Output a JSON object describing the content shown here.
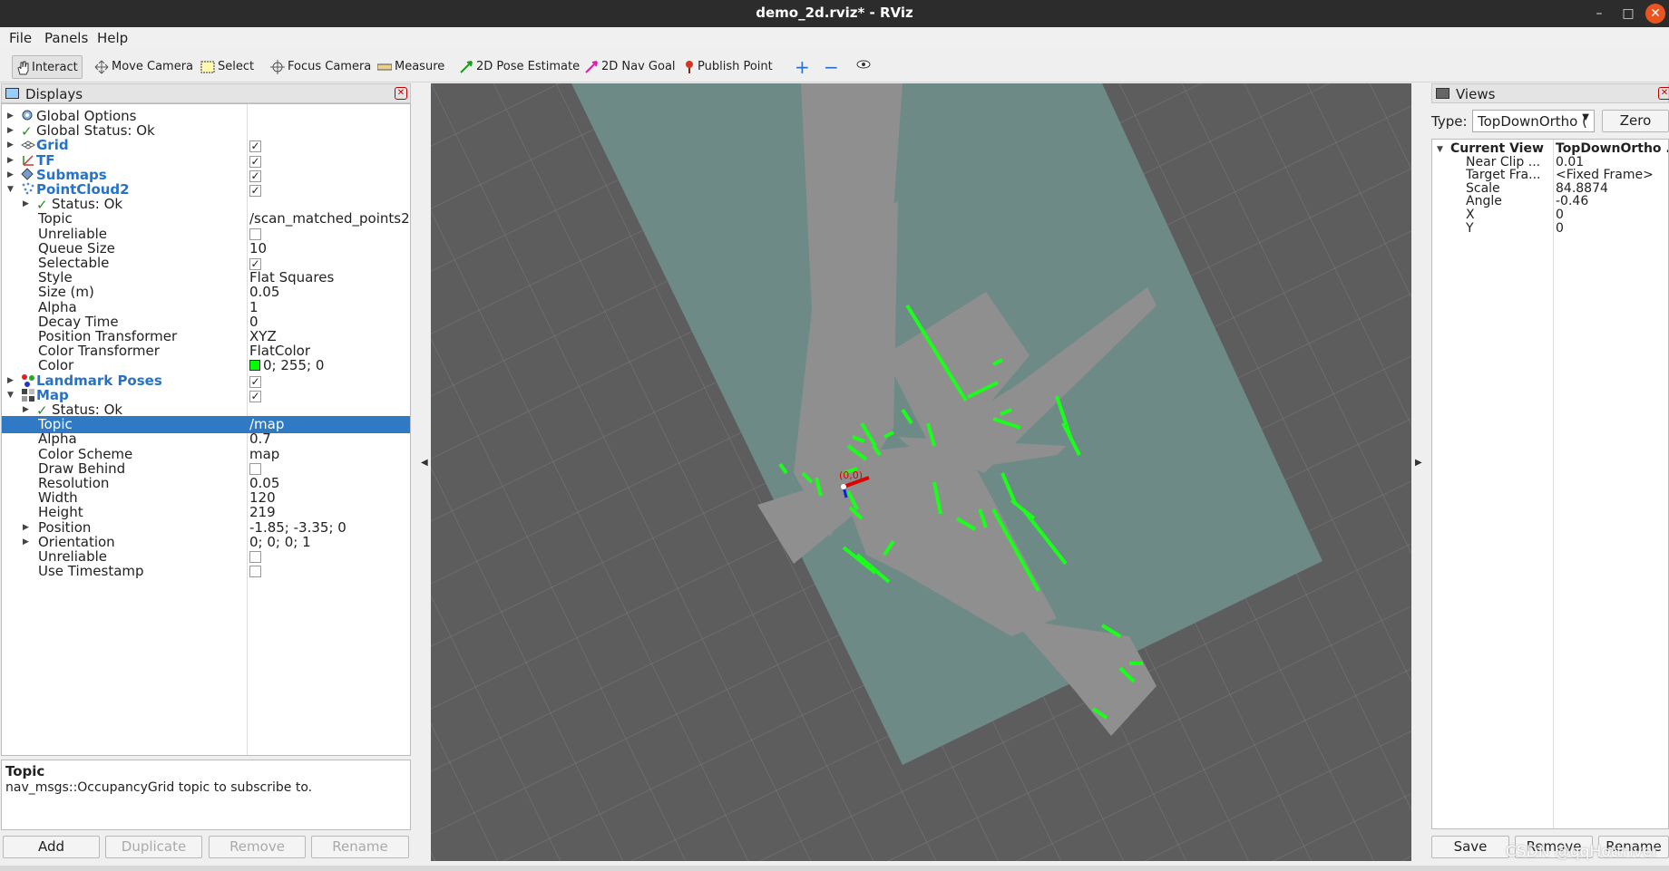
{
  "window": {
    "title": "demo_2d.rviz* - RViz"
  },
  "menu": [
    "File",
    "Panels",
    "Help"
  ],
  "toolbar": [
    {
      "label": "Interact",
      "icon": "hand-icon"
    },
    {
      "label": "Move Camera",
      "icon": "move-icon"
    },
    {
      "label": "Select",
      "icon": "select-icon"
    },
    {
      "label": "Focus Camera",
      "icon": "focus-icon"
    },
    {
      "label": "Measure",
      "icon": "ruler-icon"
    },
    {
      "label": "2D Pose Estimate",
      "icon": "green-arrow-icon"
    },
    {
      "label": "2D Nav Goal",
      "icon": "pink-arrow-icon"
    },
    {
      "label": "Publish Point",
      "icon": "pin-icon"
    }
  ],
  "displays": {
    "title": "Displays",
    "rows": [
      {
        "name": "Global Options",
        "value": ""
      },
      {
        "name": "Global Status: Ok",
        "value": ""
      },
      {
        "name": "Grid",
        "value": ""
      },
      {
        "name": "TF",
        "value": ""
      },
      {
        "name": "Submaps",
        "value": ""
      },
      {
        "name": "PointCloud2",
        "value": ""
      },
      {
        "name": "Status: Ok",
        "value": ""
      },
      {
        "name": "Topic",
        "value": "/scan_matched_points2"
      },
      {
        "name": "Unreliable",
        "value": ""
      },
      {
        "name": "Queue Size",
        "value": "10"
      },
      {
        "name": "Selectable",
        "value": ""
      },
      {
        "name": "Style",
        "value": "Flat Squares"
      },
      {
        "name": "Size (m)",
        "value": "0.05"
      },
      {
        "name": "Alpha",
        "value": "1"
      },
      {
        "name": "Decay Time",
        "value": "0"
      },
      {
        "name": "Position Transformer",
        "value": "XYZ"
      },
      {
        "name": "Color Transformer",
        "value": "FlatColor"
      },
      {
        "name": "Color",
        "value": "0; 255; 0"
      },
      {
        "name": "Landmark Poses",
        "value": ""
      },
      {
        "name": "Map",
        "value": ""
      },
      {
        "name": "Status: Ok",
        "value": ""
      },
      {
        "name": "Topic",
        "value": "/map"
      },
      {
        "name": "Alpha",
        "value": "0.7"
      },
      {
        "name": "Color Scheme",
        "value": "map"
      },
      {
        "name": "Draw Behind",
        "value": ""
      },
      {
        "name": "Resolution",
        "value": "0.05"
      },
      {
        "name": "Width",
        "value": "120"
      },
      {
        "name": "Height",
        "value": "219"
      },
      {
        "name": "Position",
        "value": "-1.85; -3.35; 0"
      },
      {
        "name": "Orientation",
        "value": "0; 0; 0; 1"
      },
      {
        "name": "Unreliable",
        "value": ""
      },
      {
        "name": "Use Timestamp",
        "value": ""
      }
    ],
    "checked": {
      "Grid": true,
      "TF": true,
      "Submaps": true,
      "PointCloud2": true,
      "Landmark Poses": true,
      "Map": true,
      "PointCloud2.Unreliable": false,
      "PointCloud2.Selectable": true,
      "Map.Draw Behind": false,
      "Map.Unreliable": false,
      "Map.Use Timestamp": false
    },
    "color_swatch": "#00ff00",
    "selected_row": "Map.Topic"
  },
  "description": {
    "title": "Topic",
    "text": "nav_msgs::OccupancyGrid topic to subscribe to."
  },
  "buttons": {
    "add": "Add",
    "duplicate": "Duplicate",
    "remove": "Remove",
    "rename": "Rename"
  },
  "views": {
    "title": "Views",
    "type_label": "Type:",
    "type_value": "TopDownOrtho (",
    "zero": "Zero",
    "rows": [
      {
        "name": "Current View",
        "value": "TopDownOrtho ..."
      },
      {
        "name": "Near Clip ...",
        "value": "0.01"
      },
      {
        "name": "Target Fra...",
        "value": "<Fixed Frame>"
      },
      {
        "name": "Scale",
        "value": "84.8874"
      },
      {
        "name": "Angle",
        "value": "-0.46"
      },
      {
        "name": "X",
        "value": "0"
      },
      {
        "name": "Y",
        "value": "0"
      }
    ],
    "save": "Save",
    "remove": "Remove",
    "rename": "Rename"
  },
  "scene": {
    "tf_label": "(0,0)"
  },
  "watermark": "CSDN @qqHottriver"
}
